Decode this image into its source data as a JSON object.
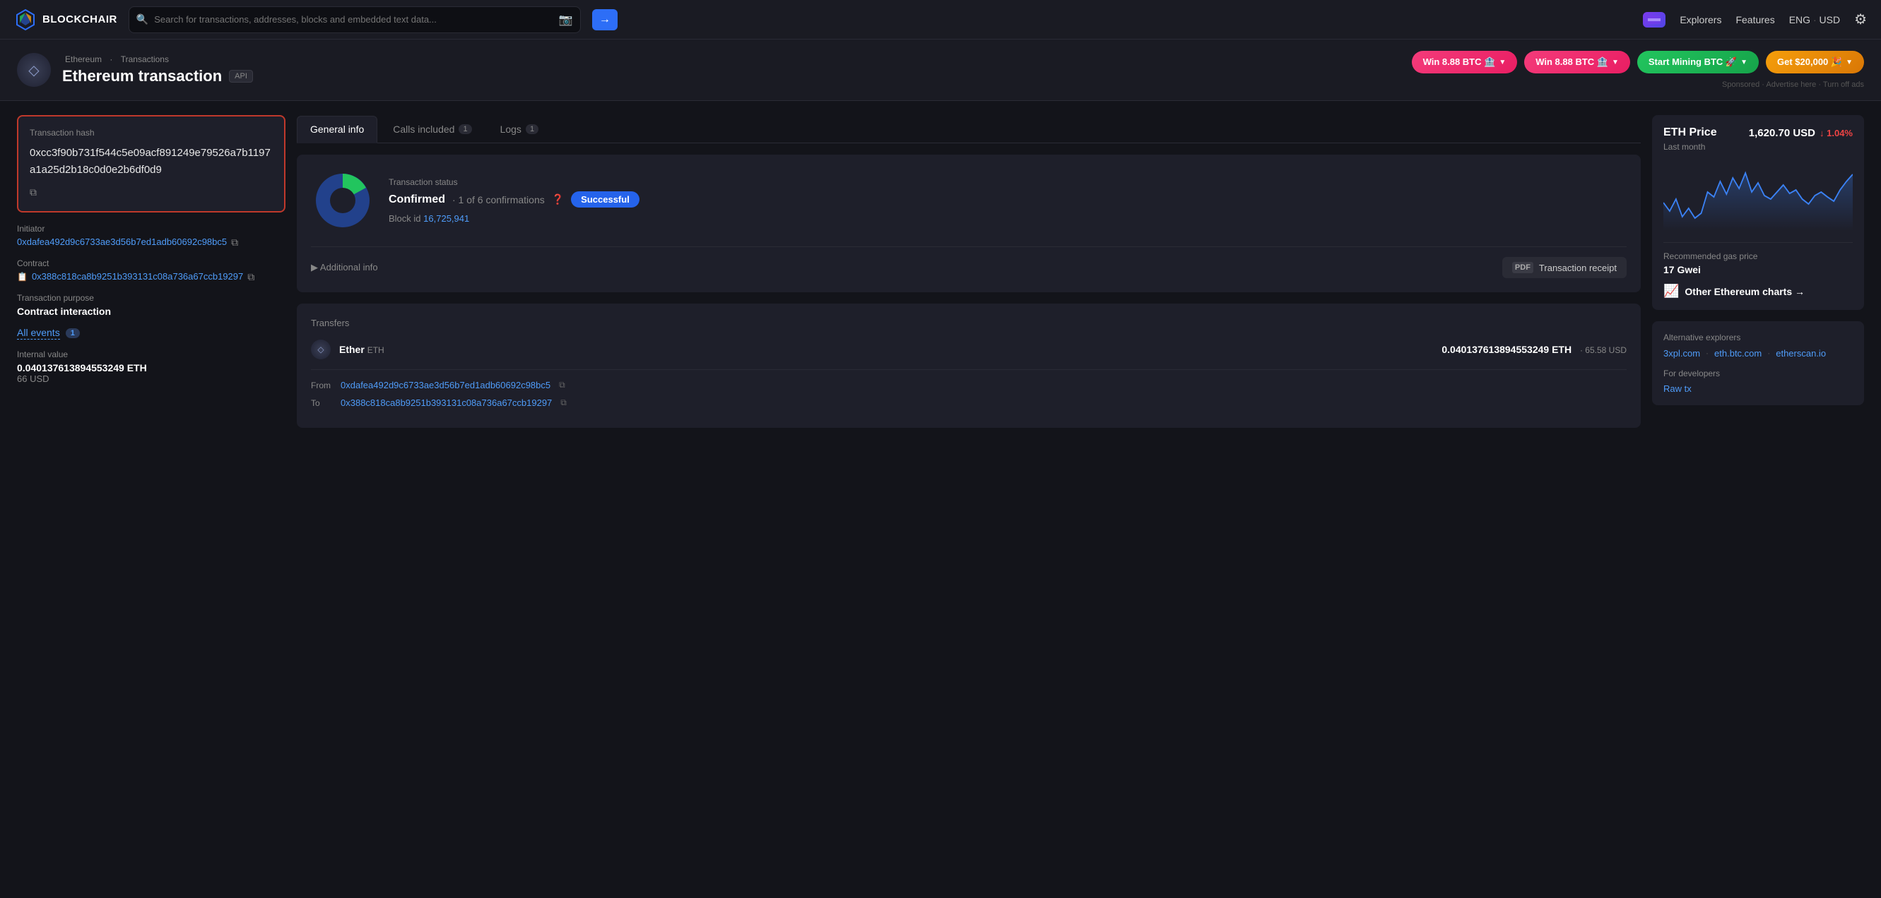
{
  "header": {
    "logo_text": "BLOCKCHAIR",
    "search_placeholder": "Search for transactions, addresses, blocks and embedded text data...",
    "nav_explorers": "Explorers",
    "nav_features": "Features",
    "nav_lang": "ENG",
    "nav_currency": "USD"
  },
  "page_header": {
    "breadcrumb_chain": "Ethereum",
    "breadcrumb_sep": "·",
    "breadcrumb_section": "Transactions",
    "title": "Ethereum transaction",
    "api_badge": "API",
    "promo_buttons": [
      {
        "label": "Win 8.88 BTC 🏦",
        "style": "pink"
      },
      {
        "label": "Win 8.88 BTC 🏦",
        "style": "pink"
      },
      {
        "label": "Start Mining BTC 🚀",
        "style": "green"
      },
      {
        "label": "Get $20,000 🎉",
        "style": "orange"
      }
    ],
    "sponsored_text": "Sponsored · Advertise here · Turn off ads"
  },
  "left": {
    "tx_hash_label": "Transaction hash",
    "tx_hash": "0xcc3f90b731f544c5e09acf891249e79526a7b1197a1a25d2b18c0d0e2b6df0d9",
    "initiator_label": "Initiator",
    "initiator_addr": "0xdafea492d9c6733ae3d56b7ed1adb60692c98bc5",
    "contract_label": "Contract",
    "contract_addr": "0x388c818ca8b9251b393131c08a736a67ccb19297",
    "purpose_label": "Transaction purpose",
    "purpose_value": "Contract interaction",
    "all_events_label": "All events",
    "all_events_count": "1",
    "internal_value_label": "Internal value",
    "internal_eth": "0.0401376138945532​49 ETH",
    "internal_eth_marker": "·",
    "internal_usd": "66 USD"
  },
  "tabs": [
    {
      "label": "General info",
      "badge": null,
      "active": true
    },
    {
      "label": "Calls included",
      "badge": "1",
      "active": false
    },
    {
      "label": "Logs",
      "badge": "1",
      "active": false
    }
  ],
  "general_info": {
    "tx_status_label": "Transaction status",
    "tx_confirmed": "Confirmed",
    "tx_confirmations": "· 1 of 6 confirmations",
    "tx_status_badge": "Successful",
    "block_id_label": "Block id",
    "block_id": "16,725,941",
    "additional_info_label": "▶ Additional info",
    "receipt_label": "Transaction receipt",
    "transfers_label": "Transfers",
    "ether_label": "Ether",
    "ether_ticker": "ETH",
    "transfer_eth_amount": "0.0401376138945532​49 ETH",
    "transfer_usd_amount": "· 65.58 USD",
    "from_label": "From",
    "from_addr": "0xdafea492d9c6733ae3d56b7ed1adb60692c98bc5",
    "to_label": "To",
    "to_addr": "0x388c818ca8b9251b393131c08a736a67ccb19297"
  },
  "right": {
    "price_title": "ETH Price",
    "price_value": "1,620.70 USD",
    "price_change": "↓ 1.04%",
    "price_period": "Last month",
    "gas_label": "Recommended gas price",
    "gas_value": "17 Gwei",
    "other_charts_label": "Other Ethereum charts →",
    "alt_explorers_label": "Alternative explorers",
    "alt_links": [
      "3xpl.com",
      "eth.btc.com",
      "etherscan.io"
    ],
    "for_dev_label": "For developers",
    "raw_tx_label": "Raw tx",
    "chart_points": [
      50,
      38,
      45,
      30,
      42,
      28,
      35,
      55,
      48,
      60,
      52,
      65,
      58,
      72,
      55,
      62,
      50,
      45,
      55,
      60,
      48,
      52,
      40,
      38,
      50,
      55,
      48,
      42,
      58,
      65,
      70,
      60
    ]
  }
}
